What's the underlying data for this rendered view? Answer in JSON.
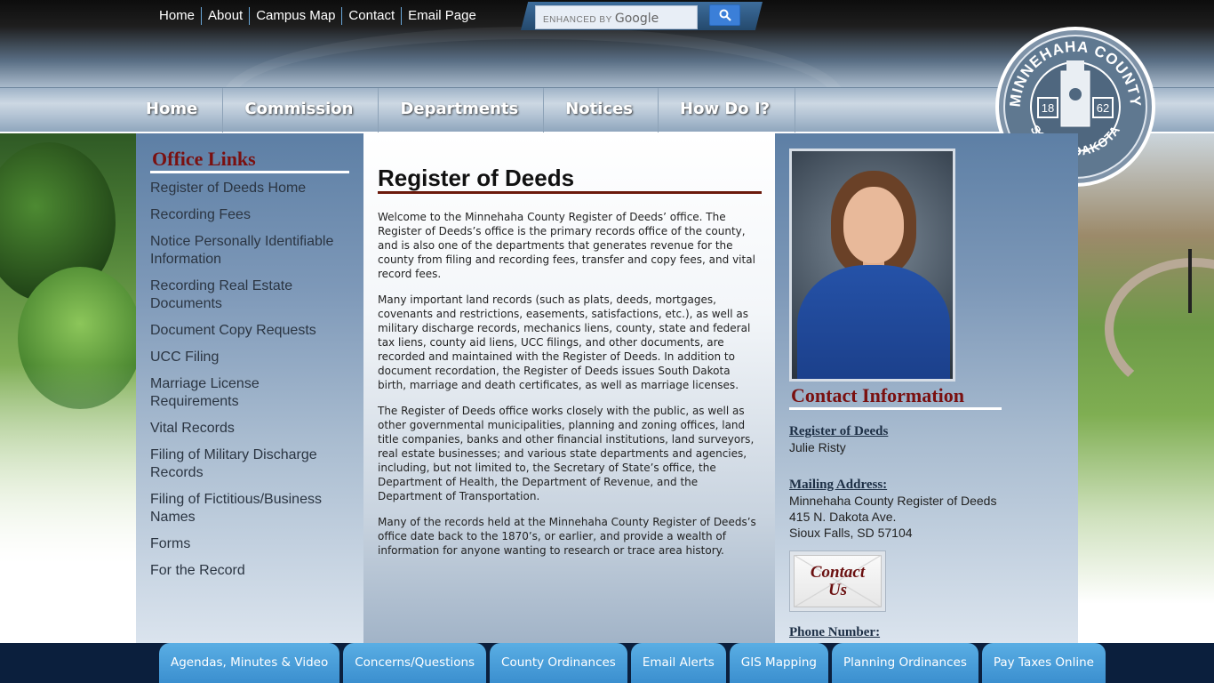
{
  "top_links": [
    "Home",
    "About",
    "Campus Map",
    "Contact",
    "Email Page"
  ],
  "search": {
    "prefix": "ENHANCED BY",
    "brand": "Google"
  },
  "main_nav": [
    "Home",
    "Commission",
    "Departments",
    "Notices",
    "How Do I?"
  ],
  "seal": {
    "top_text": "MINNEHAHA COUNTY",
    "bottom_text": "SOUTH DAKOTA",
    "year_left": "18",
    "year_right": "62"
  },
  "office_links": {
    "heading": "Office Links",
    "items": [
      "Register of Deeds Home",
      "Recording Fees",
      "Notice Personally Identifiable Information",
      "Recording Real Estate Documents",
      "Document Copy Requests",
      "UCC Filing",
      "Marriage License Requirements",
      "Vital Records",
      "Filing of Military Discharge Records",
      "Filing of Fictitious/Business Names",
      "Forms",
      "For the Record"
    ]
  },
  "main": {
    "title": "Register of Deeds",
    "paragraphs": [
      "Welcome to the Minnehaha County Register of Deeds’ office. The Register of Deeds’s office is the primary records office of the county, and is also one of the departments that generates revenue for the county from filing and recording fees, transfer and copy fees, and vital record fees.",
      "Many important land records (such as plats, deeds, mortgages, covenants and restrictions, easements, satisfactions, etc.), as well as military discharge records, mechanics liens, county, state and federal tax liens, county aid liens, UCC filings, and other documents, are recorded and maintained with the Register of Deeds.   In addition to document recordation, the Register of Deeds issues South Dakota birth, marriage and death certificates, as well as marriage licenses.",
      "The Register of Deeds office works closely with the public, as well as other governmental municipalities, planning and zoning offices, land title companies, banks and other financial institutions, land surveyors, real estate businesses; and various state departments and agencies, including, but not limited to, the Secretary of State’s office, the Department of Health, the Department of Revenue, and the Department of Transportation.",
      "Many of the records held at the Minnehaha County Register of Deeds’s office date back to the 1870’s, or earlier, and provide a wealth of information for anyone wanting to research or trace area history."
    ]
  },
  "contact": {
    "heading": "Contact Information",
    "register_label": "Register of Deeds",
    "register_name": "Julie Risty",
    "mailing_label": "Mailing Address:",
    "address_lines": [
      "Minnehaha County Register of Deeds",
      "415 N. Dakota Ave.",
      "Sioux Falls, SD 57104"
    ],
    "button_line1": "Contact",
    "button_line2": "Us",
    "phone_label": "Phone Number:"
  },
  "footer_buttons": [
    "Agendas, Minutes & Video",
    "Concerns/Questions",
    "County Ordinances",
    "Email Alerts",
    "GIS Mapping",
    "Planning Ordinances",
    "Pay Taxes Online"
  ],
  "colors": {
    "heading_red": "#7a1010",
    "footer_navy": "#0b1f3d",
    "footer_button": "#4aa0dc",
    "panel_blue": "#7d98b8"
  }
}
